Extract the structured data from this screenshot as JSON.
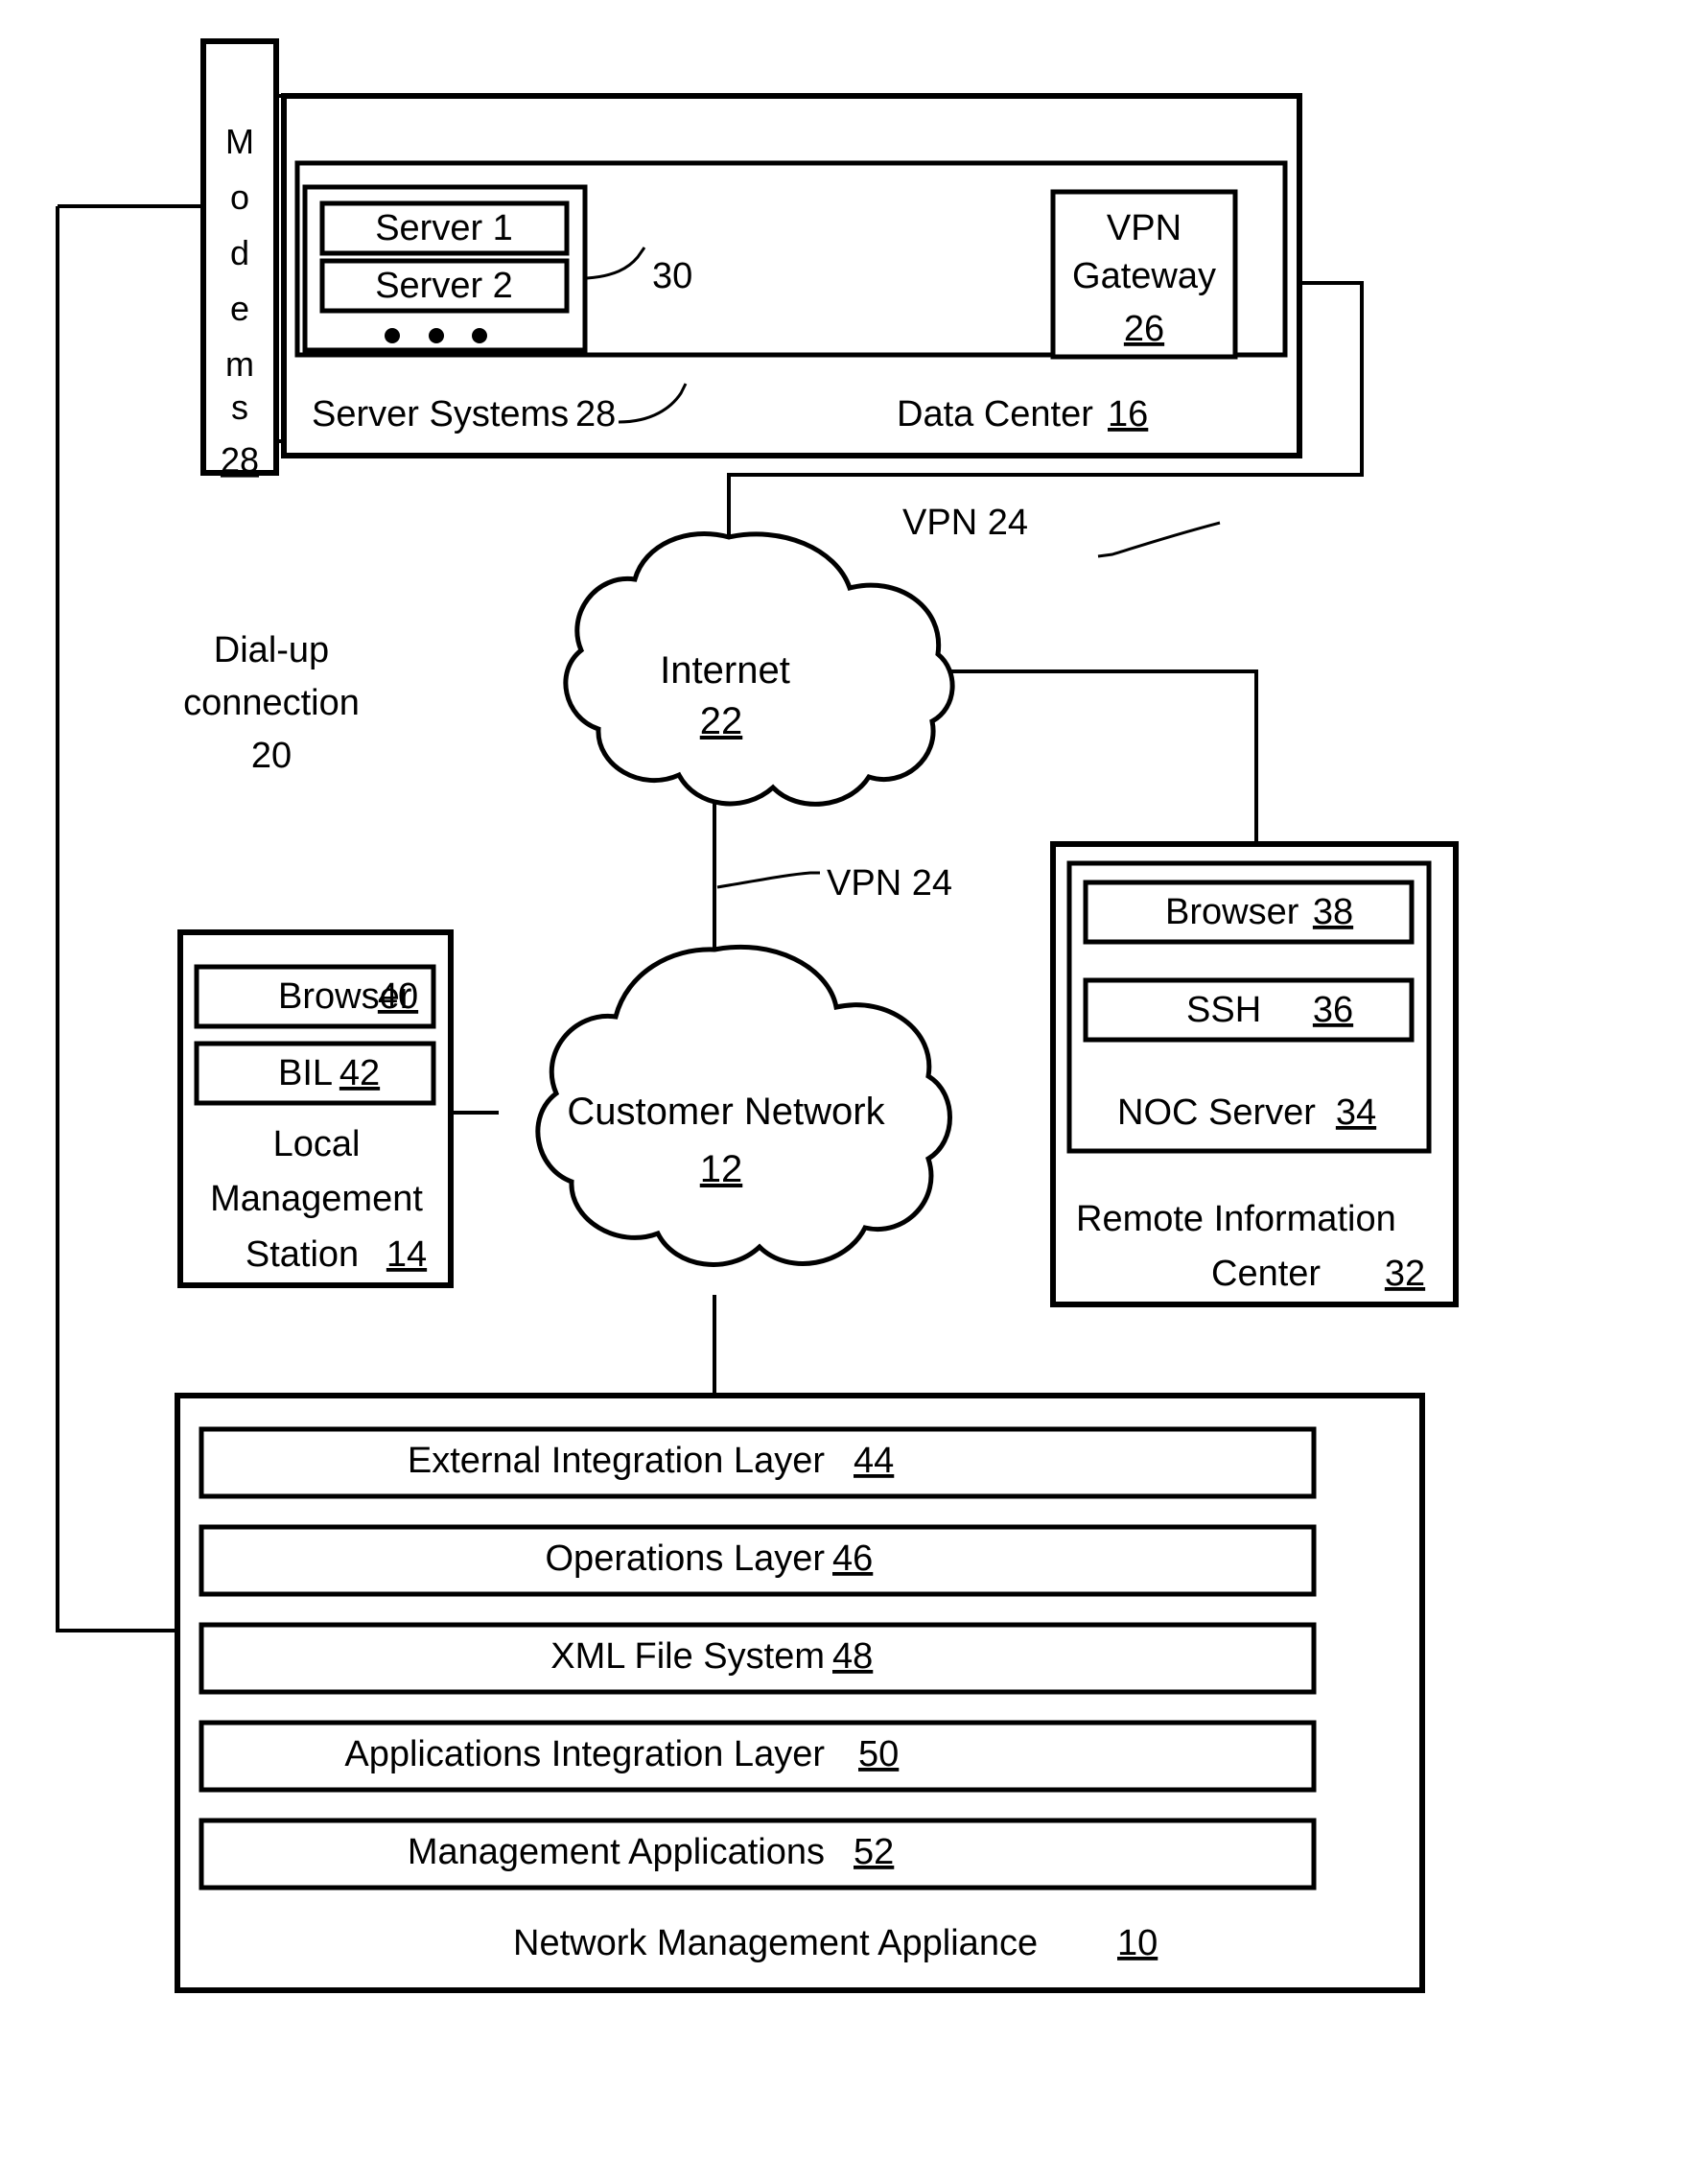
{
  "figure": {
    "type": "patent-network-diagram",
    "title": "Network Management Appliance system diagram"
  },
  "modems": {
    "label": "Modems",
    "letters": [
      "M",
      "o",
      "d",
      "e",
      "m",
      "s"
    ],
    "ref": "28"
  },
  "data_center": {
    "label": "Data Center",
    "ref": "16",
    "server_systems": {
      "label": "Server Systems",
      "ref": "28",
      "inner_ref": "30",
      "servers": [
        {
          "label": "Server 1"
        },
        {
          "label": "Server 2"
        }
      ],
      "ellipsis": "• • •"
    },
    "vpn_gateway": {
      "line1": "VPN",
      "line2": "Gateway",
      "ref": "26"
    }
  },
  "internet_cloud": {
    "label": "Internet",
    "ref": "22"
  },
  "customer_network_cloud": {
    "label": "Customer Network",
    "ref": "12"
  },
  "dialup": {
    "line1": "Dial-up",
    "line2": "connection",
    "ref": "20"
  },
  "vpn_labels": {
    "top": "VPN 24",
    "middle": "VPN 24"
  },
  "local_management_station": {
    "browser": {
      "label": "Browser",
      "ref": "40"
    },
    "bil": {
      "label": "BIL",
      "ref": "42"
    },
    "title_line1": "Local",
    "title_line2": "Management",
    "title_line3": "Station",
    "ref": "14"
  },
  "remote_information_center": {
    "browser": {
      "label": "Browser",
      "ref": "38"
    },
    "ssh": {
      "label": "SSH",
      "ref": "36"
    },
    "noc_server": {
      "label": "NOC Server",
      "ref": "34"
    },
    "title_line1": "Remote Information",
    "title_line2": "Center",
    "ref": "32"
  },
  "network_management_appliance": {
    "title": "Network Management Appliance",
    "ref": "10",
    "layers": [
      {
        "label": "External Integration Layer",
        "ref": "44"
      },
      {
        "label": "Operations Layer",
        "ref": "46"
      },
      {
        "label": "XML File System",
        "ref": "48"
      },
      {
        "label": "Applications Integration Layer",
        "ref": "50"
      },
      {
        "label": "Management Applications",
        "ref": "52"
      }
    ]
  }
}
